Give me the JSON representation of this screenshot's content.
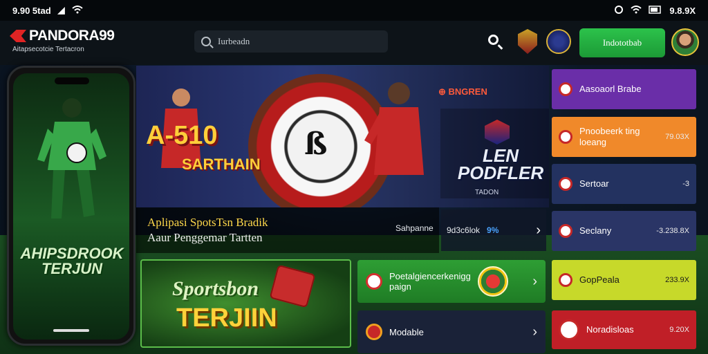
{
  "status_bar": {
    "left_text": "9.90 5tad",
    "right_text": "9.8.9X"
  },
  "header": {
    "brand": "PANDORA99",
    "tagline": "Aitapsecotcie Tertacron",
    "search_placeholder": "Iurbeadn",
    "signup_label": "Indototbab"
  },
  "phone": {
    "title_line1": "AHIPSDROOK",
    "title_line2": "TERJUN"
  },
  "hero": {
    "title": "A-510",
    "subtitle": "SARTHAIN",
    "tag": "⊕ BNGREN",
    "brand_line1": "LEN",
    "brand_line2": "PODFLER",
    "brand_sub": "TADON"
  },
  "caption": {
    "line1": "Aplipasi SpotsTsn Bradik",
    "line2": "Aaur Penggemar Tartten",
    "label": "Sahpanne",
    "stat_label": "9d3c6lok",
    "stat_pct": "9%"
  },
  "sportsbook": {
    "title": "Sportsbon",
    "subtitle": "TERJIIN"
  },
  "mid_list": [
    {
      "label": "Poetalgiencerkenigg",
      "sub": "paign"
    },
    {
      "label": "Modable"
    }
  ],
  "right_list": [
    {
      "label": "Aasoaorl Brabe",
      "value": ""
    },
    {
      "label": "Pnoobeerk ting",
      "sub": "loeang",
      "value": "79.03X"
    },
    {
      "label": "Sertoar",
      "value": "-3"
    },
    {
      "label": "Seclany",
      "value": "-3.238.8X"
    },
    {
      "label": "GopPeala",
      "value": "233.9X"
    },
    {
      "label": "Noradisloas",
      "value": "9.20X"
    }
  ],
  "colors": {
    "accent_green": "#2cc24b",
    "gold": "#ffcf3a",
    "purple": "#6a2ea8",
    "orange": "#f0892a",
    "lime": "#c7d92a",
    "red": "#c01f27"
  }
}
